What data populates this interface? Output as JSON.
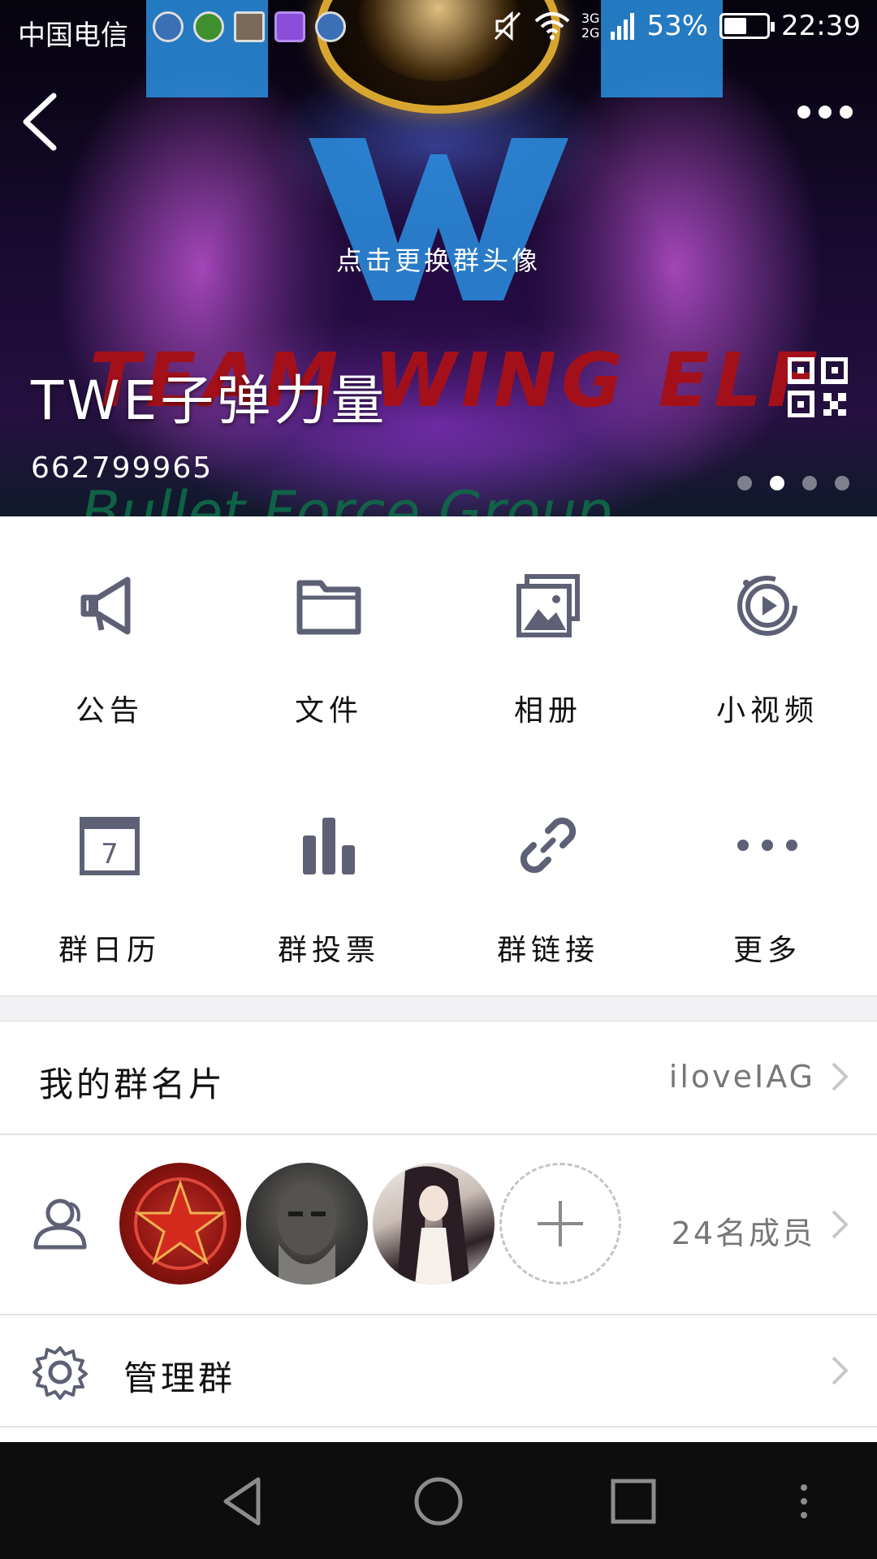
{
  "status_bar": {
    "carrier": "中国电信",
    "network_top": "3G",
    "network_bottom": "2G",
    "battery": "53%",
    "battery_level": 0.53,
    "time": "22:39"
  },
  "hero": {
    "change_avatar_label": "点击更换群头像",
    "group_name": "TWE子弹力量",
    "group_id": "662799965",
    "banner_word_red": "TEAM WING ELF",
    "banner_word_green": "Bullet Force Group",
    "page_dots": 4,
    "active_dot": 2
  },
  "grid": {
    "items": [
      {
        "label": "公告",
        "icon": "megaphone-icon"
      },
      {
        "label": "文件",
        "icon": "folder-icon"
      },
      {
        "label": "相册",
        "icon": "photo-album-icon"
      },
      {
        "label": "小视频",
        "icon": "video-play-icon"
      },
      {
        "label": "群日历",
        "icon": "calendar-icon"
      },
      {
        "label": "群投票",
        "icon": "bar-chart-icon"
      },
      {
        "label": "群链接",
        "icon": "link-icon"
      },
      {
        "label": "更多",
        "icon": "more-dots-icon"
      }
    ]
  },
  "rows": {
    "card_label": "我的群名片",
    "card_value": "iloveIAG",
    "members_value": "24名成员",
    "manage_label": "管理群"
  },
  "colors": {
    "icon_gray": "#5e6175",
    "chevron": "#c8c8cc",
    "nav_bg": "#0d0d0d"
  }
}
